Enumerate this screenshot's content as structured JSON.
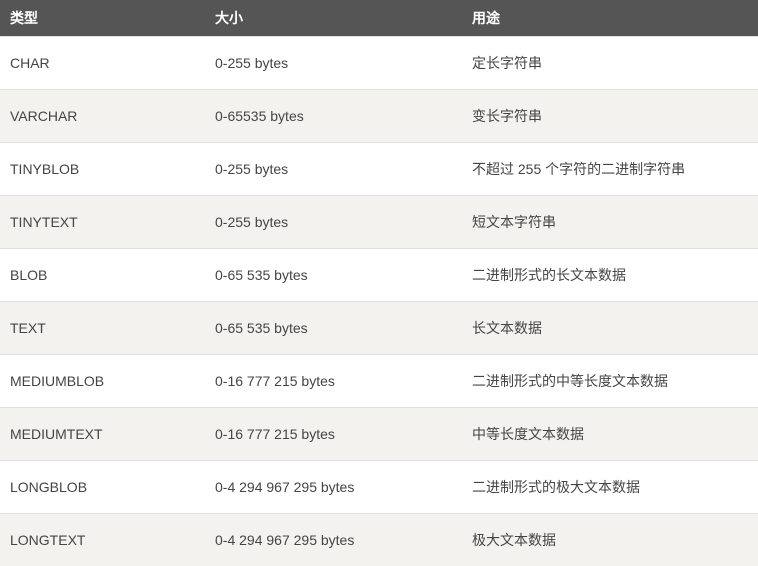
{
  "table": {
    "headers": {
      "type": "类型",
      "size": "大小",
      "usage": "用途"
    },
    "rows": [
      {
        "type": "CHAR",
        "size": "0-255 bytes",
        "usage": "定长字符串"
      },
      {
        "type": "VARCHAR",
        "size": "0-65535 bytes",
        "usage": "变长字符串"
      },
      {
        "type": "TINYBLOB",
        "size": "0-255 bytes",
        "usage": "不超过 255 个字符的二进制字符串"
      },
      {
        "type": "TINYTEXT",
        "size": "0-255 bytes",
        "usage": "短文本字符串"
      },
      {
        "type": "BLOB",
        "size": "0-65 535 bytes",
        "usage": "二进制形式的长文本数据"
      },
      {
        "type": "TEXT",
        "size": "0-65 535 bytes",
        "usage": "长文本数据"
      },
      {
        "type": "MEDIUMBLOB",
        "size": "0-16 777 215 bytes",
        "usage": "二进制形式的中等长度文本数据"
      },
      {
        "type": "MEDIUMTEXT",
        "size": "0-16 777 215 bytes",
        "usage": "中等长度文本数据"
      },
      {
        "type": "LONGBLOB",
        "size": "0-4 294 967 295 bytes",
        "usage": "二进制形式的极大文本数据"
      },
      {
        "type": "LONGTEXT",
        "size": "0-4 294 967 295 bytes",
        "usage": "极大文本数据"
      }
    ]
  }
}
